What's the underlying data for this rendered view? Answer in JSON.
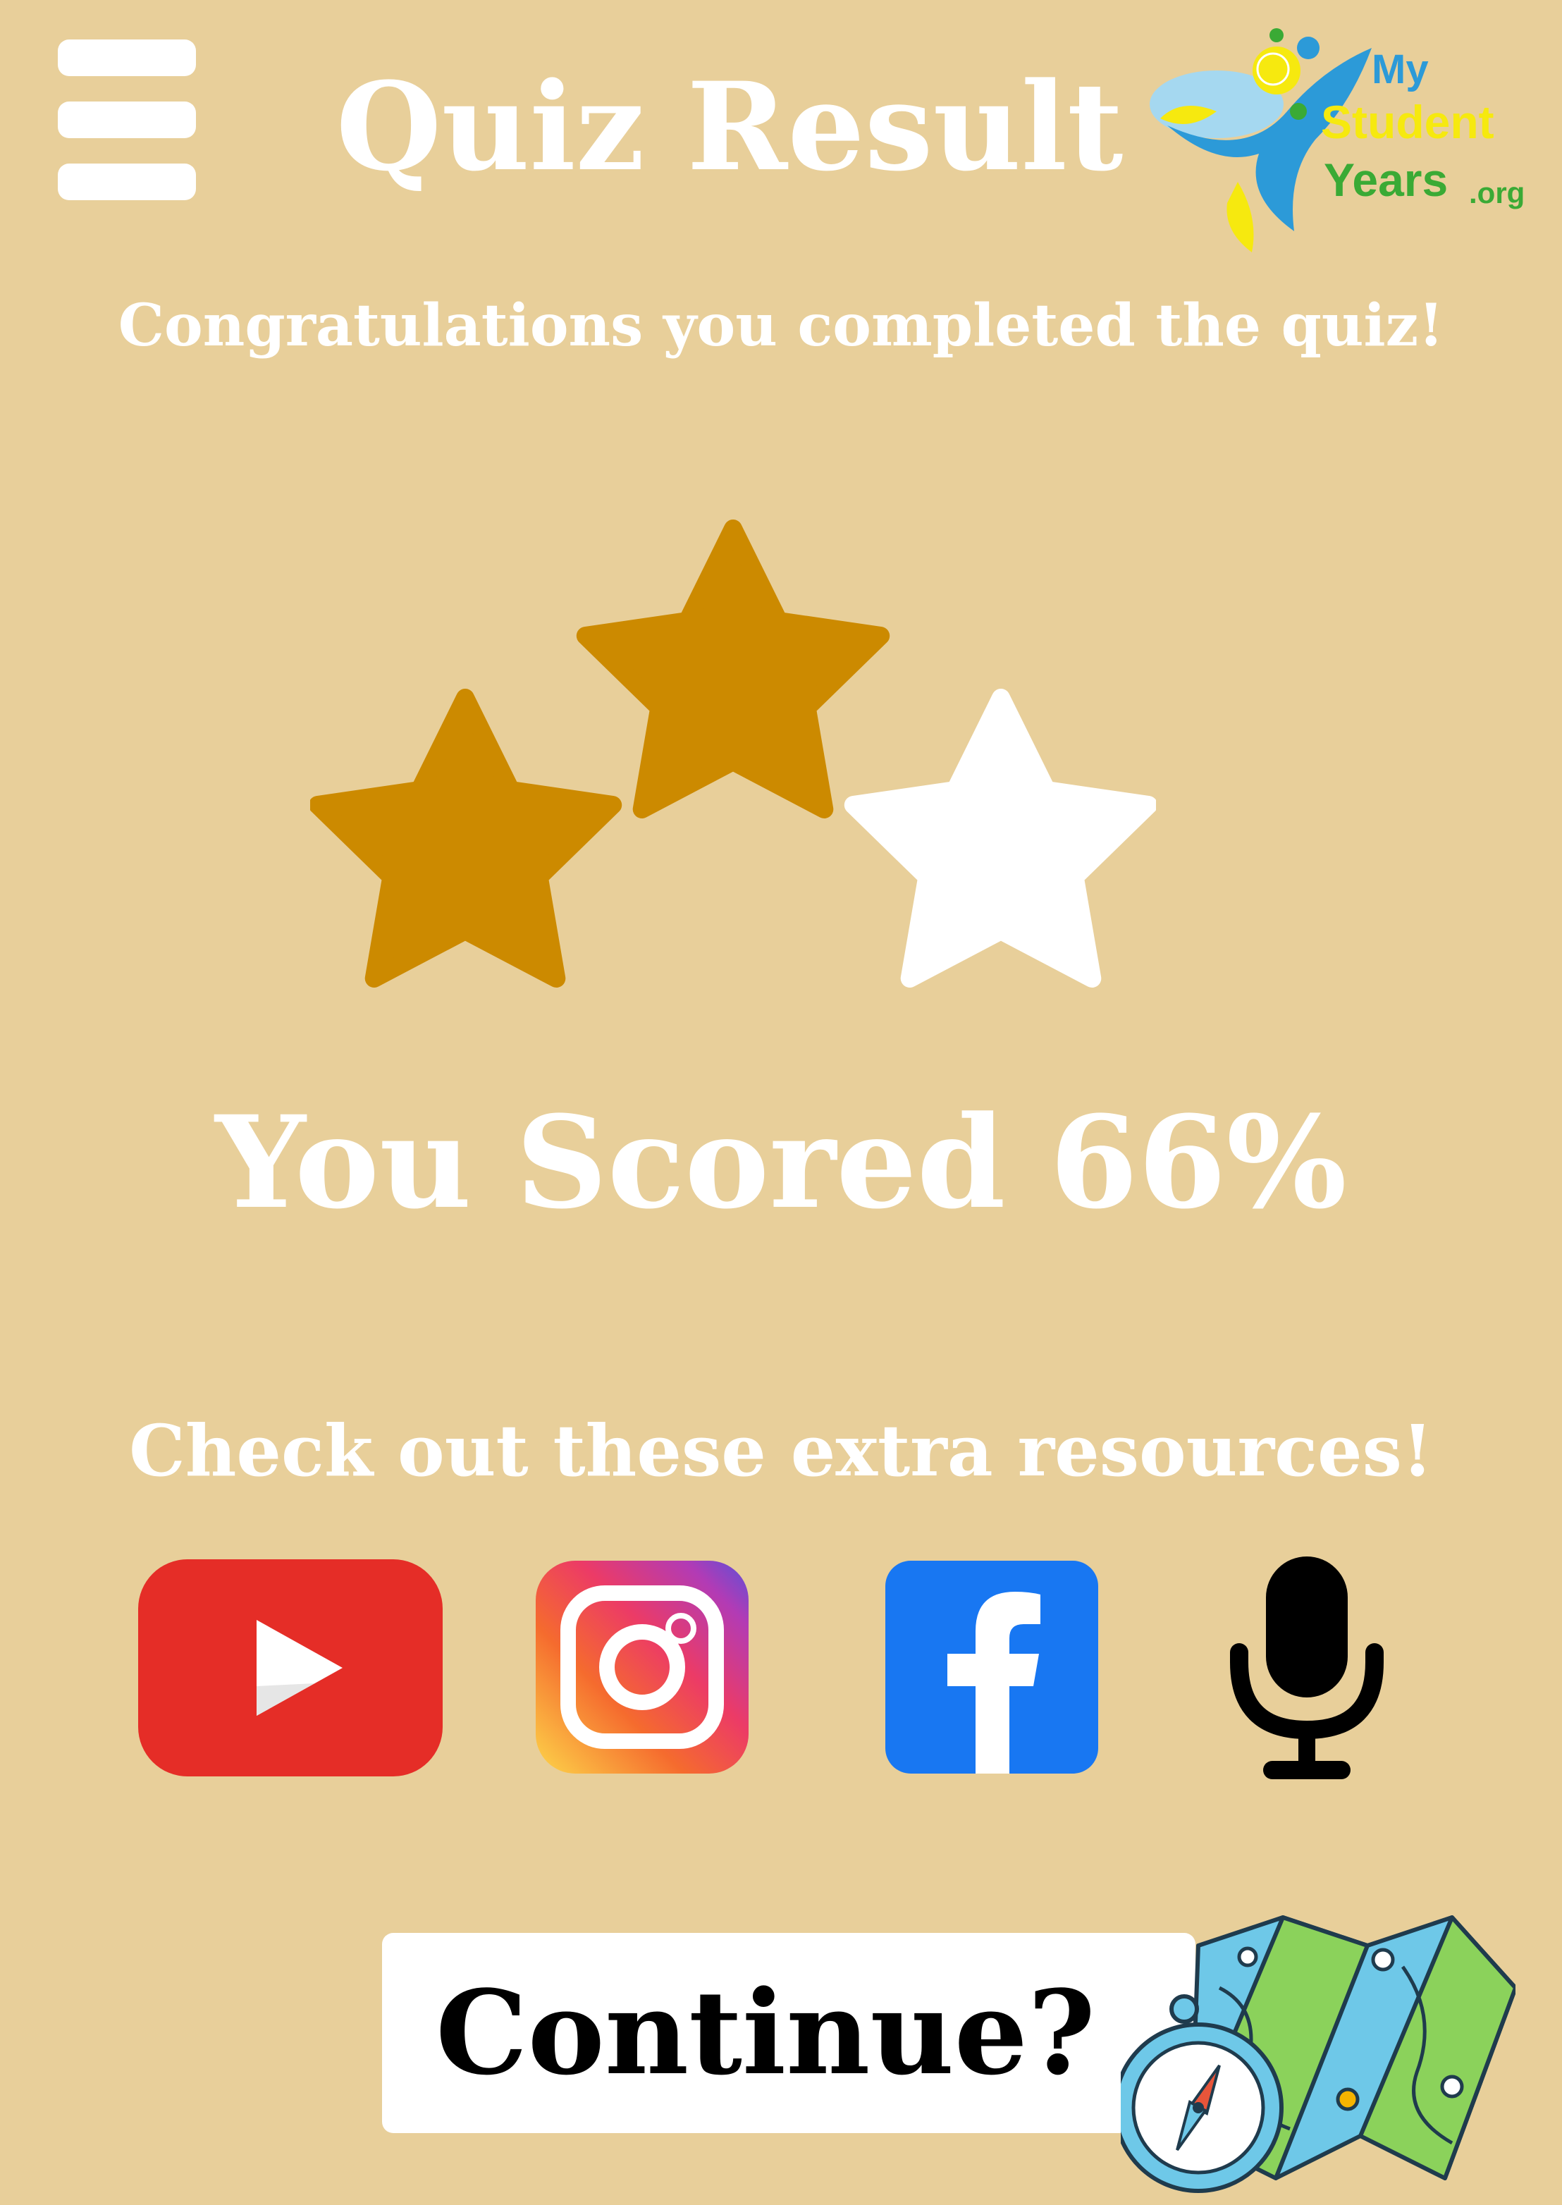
{
  "header": {
    "title": "Quiz Result",
    "menu_icon": "hamburger-menu-icon",
    "logo": {
      "name": "mystudentyears-logo",
      "text_my": "My",
      "text_student": "Student",
      "text_years": "Years",
      "text_org": ".org"
    }
  },
  "congrats_text": "Congratulations you completed the quiz!",
  "rating": {
    "stars_earned": 2,
    "stars_total": 3,
    "filled_color": "#cc8a00",
    "empty_color": "#ffffff"
  },
  "score_text": "You Scored 66%",
  "resources": {
    "heading": "Check out these extra resources!",
    "items": [
      {
        "name": "youtube",
        "icon": "youtube-icon",
        "color": "#e52d27"
      },
      {
        "name": "instagram",
        "icon": "instagram-icon",
        "color": "#d6249f"
      },
      {
        "name": "facebook",
        "icon": "facebook-icon",
        "color": "#1877f2"
      },
      {
        "name": "podcast",
        "icon": "microphone-icon",
        "color": "#000000"
      }
    ]
  },
  "continue_button": {
    "label": "Continue?",
    "illustration": "map-compass-icon"
  },
  "colors": {
    "background": "#e8cf9a",
    "text": "#ffffff"
  }
}
